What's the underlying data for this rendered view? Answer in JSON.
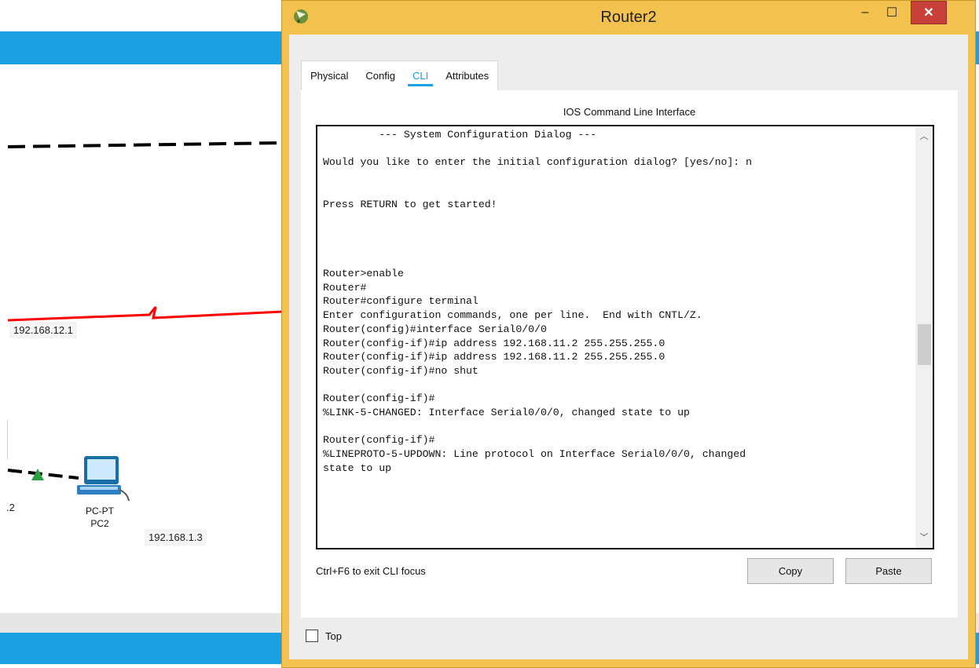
{
  "workspace": {
    "labels": {
      "link_ip": "192.168.12.1",
      "left_ip_fragment": ".2",
      "pc_type": "PC-PT",
      "pc_name": "PC2",
      "pc_ip": "192.168.1.3"
    },
    "colors": {
      "accent_bar": "#1ba1e2",
      "serial_link": "#ff0000",
      "ethernet_link": "#000000",
      "link_status_up": "#2ea043"
    }
  },
  "window": {
    "title": "Router2",
    "controls": {
      "minimize": "–",
      "maximize": "☐",
      "close": "✕"
    },
    "tabs": [
      {
        "label": "Physical",
        "active": false
      },
      {
        "label": "Config",
        "active": false
      },
      {
        "label": "CLI",
        "active": true
      },
      {
        "label": "Attributes",
        "active": false
      }
    ],
    "panel_title": "IOS Command Line Interface",
    "terminal_lines": [
      "         --- System Configuration Dialog ---",
      "",
      "Would you like to enter the initial configuration dialog? [yes/no]: n",
      "",
      "",
      "Press RETURN to get started!",
      "",
      "",
      "",
      "",
      "Router>enable",
      "Router#",
      "Router#configure terminal",
      "Enter configuration commands, one per line.  End with CNTL/Z.",
      "Router(config)#interface Serial0/0/0",
      "Router(config-if)#ip address 192.168.11.2 255.255.255.0",
      "Router(config-if)#ip address 192.168.11.2 255.255.255.0",
      "Router(config-if)#no shut",
      "",
      "Router(config-if)#",
      "%LINK-5-CHANGED: Interface Serial0/0/0, changed state to up",
      "",
      "Router(config-if)#",
      "%LINEPROTO-5-UPDOWN: Line protocol on Interface Serial0/0/0, changed",
      "state to up"
    ],
    "hint": "Ctrl+F6 to exit CLI focus",
    "buttons": {
      "copy": "Copy",
      "paste": "Paste"
    },
    "top_checkbox": {
      "label": "Top",
      "checked": false
    }
  }
}
